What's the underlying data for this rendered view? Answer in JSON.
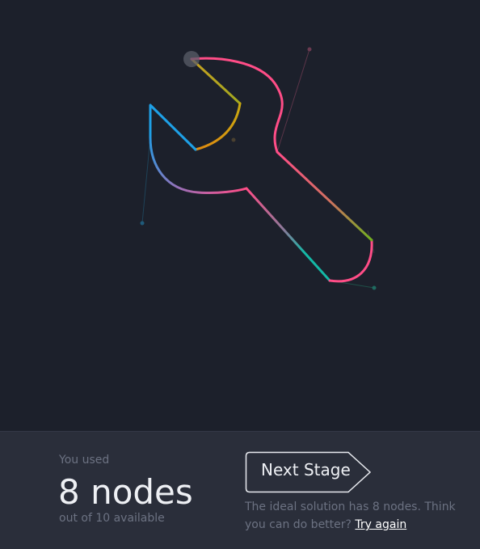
{
  "results": {
    "used_label": "You used",
    "node_count": "8 nodes",
    "available_text": "out of 10 available"
  },
  "next_button": {
    "label": "Next Stage"
  },
  "hint": {
    "text": "The ideal solution has 8 nodes. Think you can do better?",
    "try_again_label": "Try again"
  },
  "colors": {
    "background": "#1c202b",
    "panel": "#2a2e3a",
    "pink": "#ff4d87",
    "teal": "#14b8a6",
    "blue": "#1ea0e6",
    "amber": "#e0a010",
    "olive": "#a0a820",
    "muted_text": "#6c7282"
  }
}
